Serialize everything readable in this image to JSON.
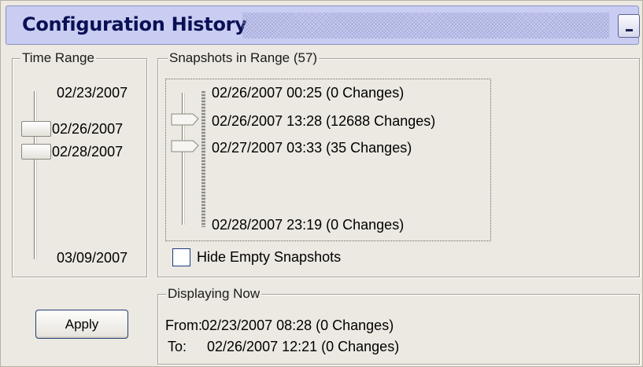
{
  "title": "Configuration History",
  "time_range": {
    "legend": "Time Range",
    "top_date": "02/23/2007",
    "thumb1_date": "02/26/2007",
    "thumb2_date": "02/28/2007",
    "bottom_date": "03/09/2007"
  },
  "snapshots": {
    "legend": "Snapshots in Range (57)",
    "items": [
      "02/26/2007 00:25 (0 Changes)",
      "02/26/2007 13:28 (12688 Changes)",
      "02/27/2007 03:33 (35 Changes)",
      "02/28/2007 23:19 (0 Changes)"
    ],
    "hide_empty_label": "Hide Empty Snapshots",
    "hide_empty_checked": false
  },
  "apply_label": "Apply",
  "displaying": {
    "legend": "Displaying Now",
    "from_label": "From:",
    "from_value": "02/23/2007 08:28 (0 Changes)",
    "to_label": "To:",
    "to_value": "02/26/2007 12:21 (0 Changes)"
  },
  "colors": {
    "title_bar": "#c9cdf2",
    "title_text": "#0a1055",
    "panel_bg": "#ece9e2"
  },
  "icons": {
    "minimize": "minimize-icon"
  }
}
